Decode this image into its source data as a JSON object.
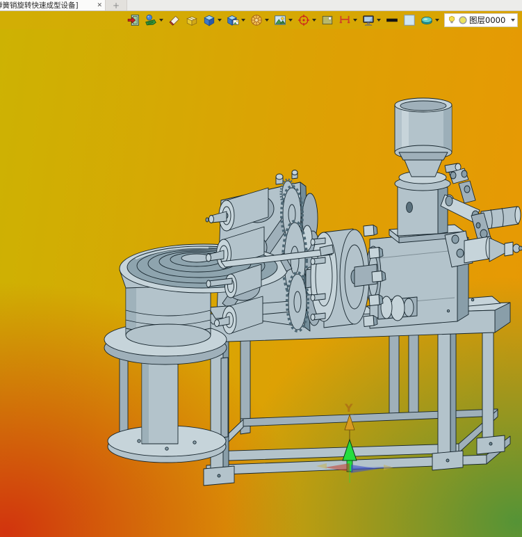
{
  "tab_bar": {
    "active_tab_title": "弹簧销旋转快速成型设备]",
    "close_glyph": "✕",
    "new_tab_glyph": "+"
  },
  "toolbar": {
    "icons": [
      {
        "name": "exit-door-icon"
      },
      {
        "name": "spray-material-icon",
        "has_dropdown": true
      },
      {
        "name": "eraser-icon"
      },
      {
        "name": "open-box-icon"
      },
      {
        "name": "shaded-cube-icon",
        "has_dropdown": true
      },
      {
        "name": "textured-cube-icon",
        "has_dropdown": true
      },
      {
        "name": "wireframe-sphere-icon",
        "has_dropdown": true
      },
      {
        "name": "render-image-icon",
        "has_dropdown": true
      },
      {
        "name": "target-point-icon",
        "has_dropdown": true
      },
      {
        "name": "viewport-panel-icon"
      },
      {
        "name": "section-bracket-icon",
        "has_dropdown": true
      },
      {
        "name": "monitor-display-icon",
        "has_dropdown": true
      },
      {
        "name": "line-width-icon"
      },
      {
        "name": "color-swatch-icon"
      },
      {
        "name": "layer-disc-icon",
        "has_dropdown": true
      }
    ],
    "layer_combo": {
      "value": "图层0000",
      "bulb_icon": "lightbulb-icon",
      "color_icon": "layer-color-icon"
    }
  },
  "viewport": {
    "gradient_corners": {
      "top_left": "#cdb303",
      "top_right": "#e89804",
      "bottom_left": "#d2300e",
      "bottom_right": "#4f9338"
    },
    "model_color": "#b3c3cb",
    "axes": {
      "y_label": "Y",
      "up_arrow_color": "#d99b22",
      "green_arrow_color": "#25dd3e",
      "red_arrow_color": "#c23a2b",
      "blue_arrow_color": "#4052c8"
    }
  }
}
